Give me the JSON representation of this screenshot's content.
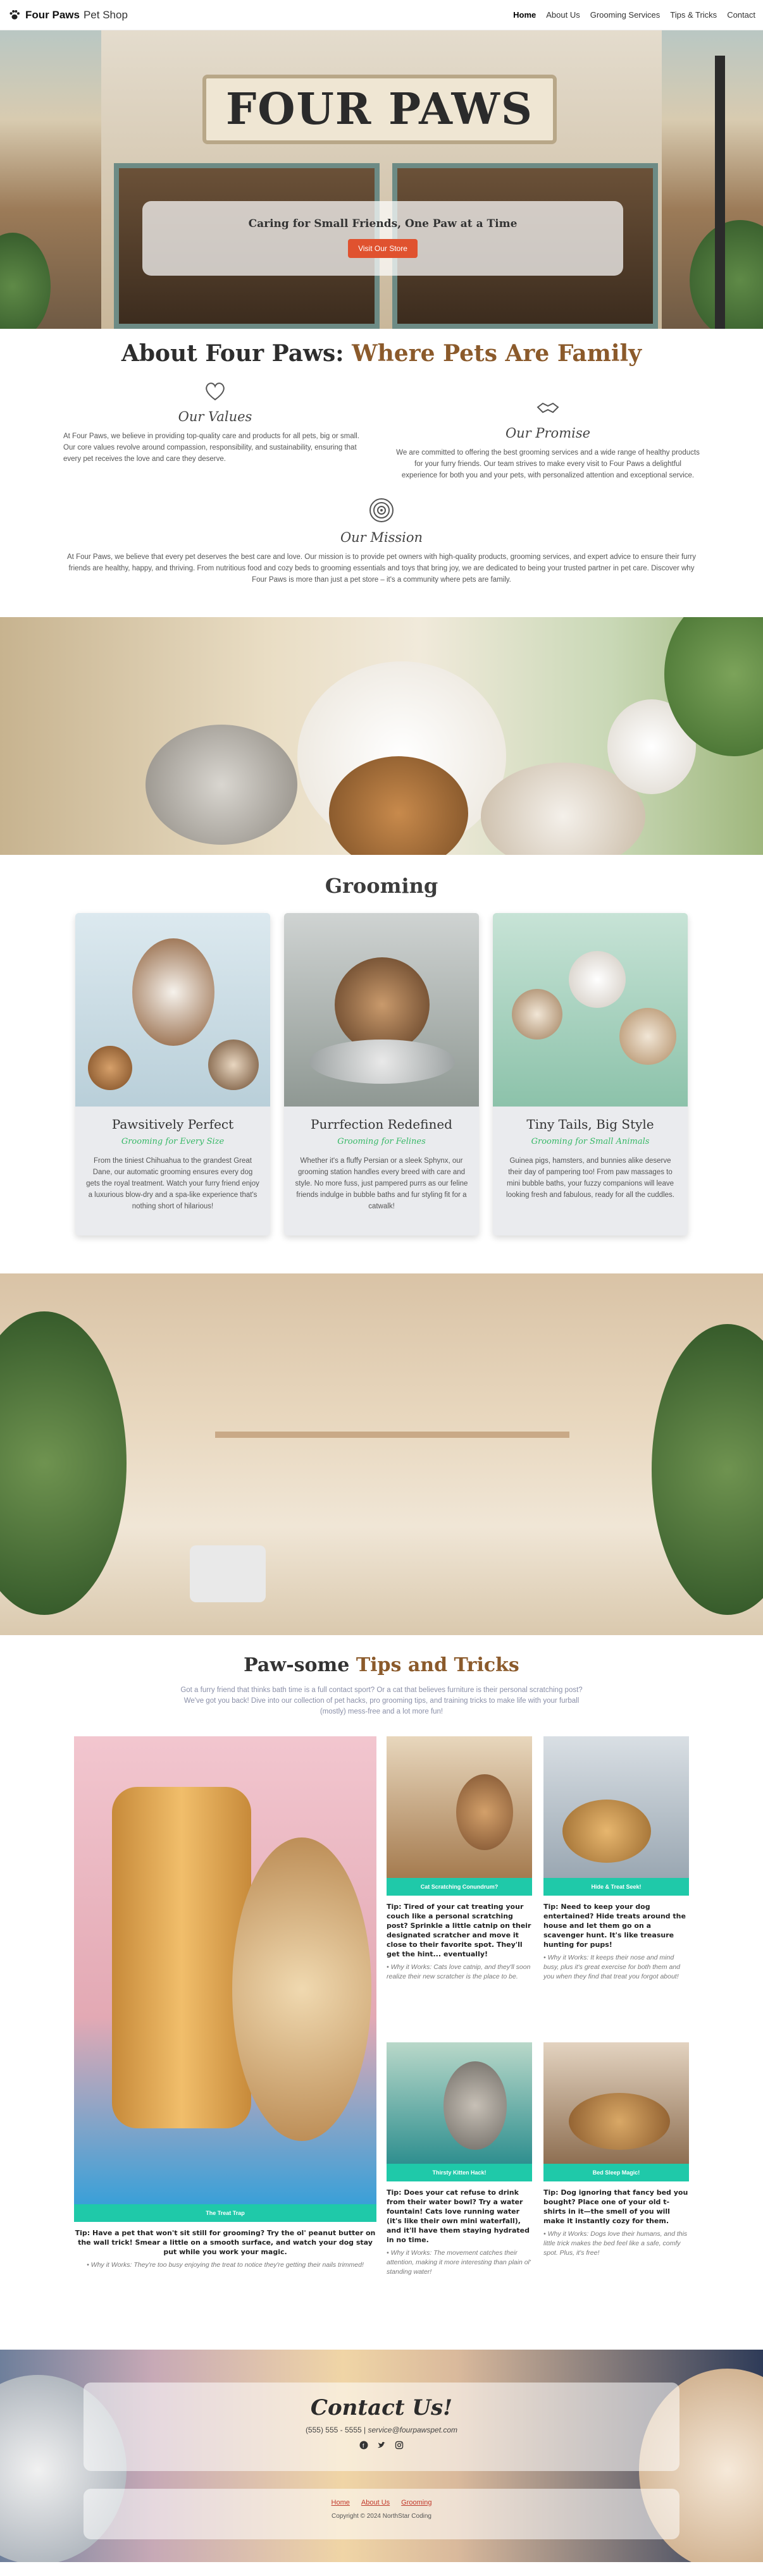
{
  "nav": {
    "brand_bold": "Four Paws",
    "brand_rest": "Pet Shop",
    "links": [
      "Home",
      "About Us",
      "Grooming Services",
      "Tips & Tricks",
      "Contact"
    ]
  },
  "hero": {
    "sign": "FOUR PAWS",
    "tagline": "Caring for Small Friends, One Paw at a Time",
    "button": "Visit Our Store"
  },
  "about": {
    "title_prefix": "About Four Paws: ",
    "title_highlight": "Where Pets Are Family",
    "values_title": "Our Values",
    "values_text": "At Four Paws, we believe in providing top-quality care and products for all pets, big or small. Our core values revolve around compassion, responsibility, and sustainability, ensuring that every pet receives the love and care they deserve.",
    "promise_title": "Our Promise",
    "promise_text": "We are committed to offering the best grooming services and a wide range of healthy products for your furry friends. Our team strives to make every visit to Four Paws a delightful experience for both you and your pets, with personalized attention and exceptional service.",
    "mission_title": "Our Mission",
    "mission_text": "At Four Paws, we believe that every pet deserves the best care and love. Our mission is to provide pet owners with high-quality products, grooming services, and expert advice to ensure their furry friends are healthy, happy, and thriving. From nutritious food and cozy beds to grooming essentials and toys that bring joy, we are dedicated to being your trusted partner in pet care. Discover why Four Paws is more than just a pet store – it's a community where pets are family."
  },
  "grooming": {
    "title": "Grooming",
    "cards": [
      {
        "title": "Pawsitively Perfect",
        "subtitle": "Grooming for Every Size",
        "text": "From the tiniest Chihuahua to the grandest Great Dane, our automatic grooming ensures every dog gets the royal treatment. Watch your furry friend enjoy a luxurious blow-dry and a spa-like experience that's nothing short of hilarious!"
      },
      {
        "title": "Purrfection Redefined",
        "subtitle": "Grooming for Felines",
        "text": "Whether it's a fluffy Persian or a sleek Sphynx, our grooming station handles every breed with care and style. No more fuss, just pampered purrs as our feline friends indulge in bubble baths and fur styling fit for a catwalk!"
      },
      {
        "title": "Tiny Tails, Big Style",
        "subtitle": "Grooming for Small Animals",
        "text": "Guinea pigs, hamsters, and bunnies alike deserve their day of pampering too! From paw massages to mini bubble baths, your fuzzy companions will leave looking fresh and fabulous, ready for all the cuddles."
      }
    ]
  },
  "tips": {
    "title_prefix": "Paw-some ",
    "title_highlight": "Tips and Tricks",
    "intro": "Got a furry friend that thinks bath time is a full contact sport? Or a cat that believes furniture is their personal scratching post? We've got you back! Dive into our collection of pet hacks, pro grooming tips, and training tricks to make life with your furball (mostly) mess-free and a lot more fun!",
    "items": [
      {
        "caption": "The Treat Trap",
        "tip": "Tip: Have a pet that won't sit still for grooming? Try the ol' peanut butter on the wall trick! Smear a little on a smooth surface, and watch your dog stay put while you work your magic.",
        "why": "• Why it Works: They're too busy enjoying the treat to notice they're getting their nails trimmed!"
      },
      {
        "caption": "Cat Scratching Conundrum?",
        "tip": "Tip: Tired of your cat treating your couch like a personal scratching post? Sprinkle a little catnip on their designated scratcher and move it close to their favorite spot. They'll get the hint... eventually!",
        "why": "• Why it Works: Cats love catnip, and they'll soon realize their new scratcher is the place to be."
      },
      {
        "caption": "Hide & Treat Seek!",
        "tip": "Tip: Need to keep your dog entertained? Hide treats around the house and let them go on a scavenger hunt. It's like treasure hunting for pups!",
        "why": "• Why it Works: It keeps their nose and mind busy, plus it's great exercise for both them and you when they find that treat you forgot about!"
      },
      {
        "caption": "Thirsty Kitten Hack!",
        "tip": "Tip: Does your cat refuse to drink from their water bowl? Try a water fountain! Cats love running water (it's like their own mini waterfall), and it'll have them staying hydrated in no time.",
        "why": "• Why it Works: The movement catches their attention, making it more interesting than plain ol' standing water!"
      },
      {
        "caption": "Bed Sleep Magic!",
        "tip": "Tip: Dog ignoring that fancy bed you bought? Place one of your old t-shirts in it—the smell of you will make it instantly cozy for them.",
        "why": "• Why it Works: Dogs love their humans, and this little trick makes the bed feel like a safe, comfy spot. Plus, it's free!"
      }
    ]
  },
  "contact": {
    "title": "Contact Us!",
    "phone": "(555) 555 - 5555",
    "separator": " | ",
    "email": "service@fourpawspet.com",
    "social_icons": [
      "facebook-icon",
      "twitter-icon",
      "instagram-icon"
    ],
    "footer_links": [
      "Home",
      "About Us",
      "Grooming"
    ],
    "copyright": "Copyright © 2024 NorthStar Coding"
  },
  "colors": {
    "accent": "#e0522f",
    "brown": "#8b5a2b",
    "teal": "#1fc9a9",
    "green": "#36b866"
  }
}
